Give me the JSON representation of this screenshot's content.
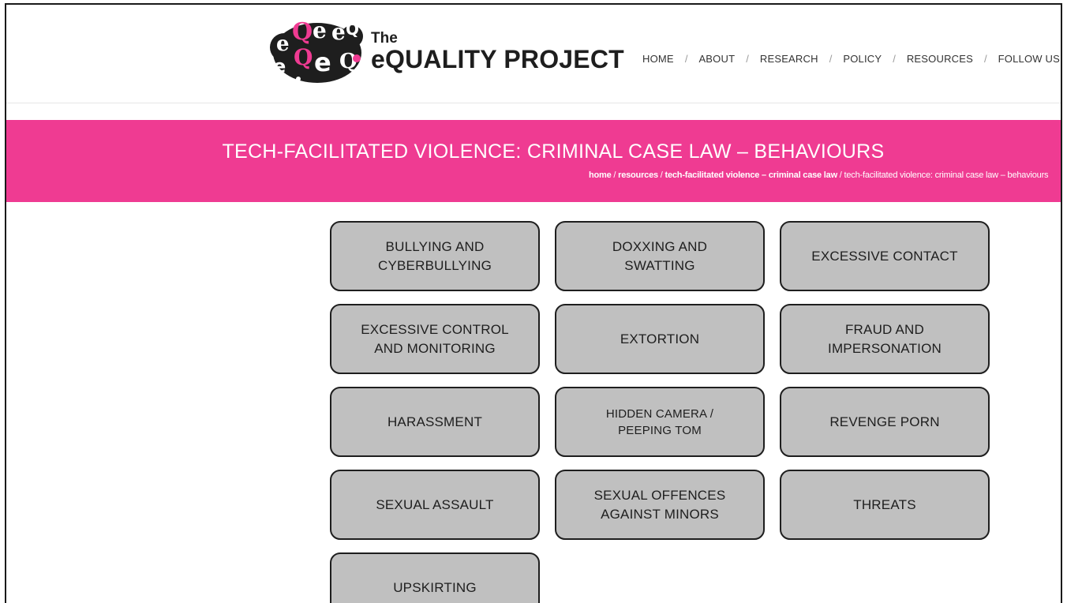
{
  "header": {
    "logo": {
      "the": "The",
      "name": "eQUALITY PROJECT",
      "mark_letters": [
        "e",
        "Q",
        "e",
        "e",
        "Q",
        "e",
        "Q",
        "e",
        "Q"
      ]
    },
    "nav": [
      {
        "label": "HOME"
      },
      {
        "label": "ABOUT"
      },
      {
        "label": "RESEARCH"
      },
      {
        "label": "POLICY"
      },
      {
        "label": "RESOURCES"
      },
      {
        "label": "FOLLOW US"
      }
    ],
    "separator": "/",
    "search_icon": "search-icon",
    "search_glyph": "Q"
  },
  "banner": {
    "title": "TECH-FACILITATED VIOLENCE: CRIMINAL CASE LAW – BEHAVIOURS",
    "breadcrumb": [
      {
        "label": "home",
        "bold": true
      },
      {
        "label": "resources",
        "bold": true
      },
      {
        "label": "tech-facilitated violence – criminal case law",
        "bold": true
      },
      {
        "label": "tech-facilitated violence: criminal case law – behaviours",
        "bold": false
      }
    ],
    "breadcrumb_separator": " / "
  },
  "categories": [
    {
      "label": "BULLYING AND CYBERBULLYING"
    },
    {
      "label": "DOXXING AND SWATTING"
    },
    {
      "label": "EXCESSIVE CONTACT"
    },
    {
      "label": "EXCESSIVE CONTROL AND MONITORING"
    },
    {
      "label": "EXTORTION"
    },
    {
      "label": "FRAUD AND IMPERSONATION"
    },
    {
      "label": "HARASSMENT"
    },
    {
      "label": "HIDDEN CAMERA / PEEPING TOM"
    },
    {
      "label": "REVENGE PORN"
    },
    {
      "label": "SEXUAL ASSAULT"
    },
    {
      "label": "SEXUAL OFFENCES AGAINST MINORS"
    },
    {
      "label": "THREATS"
    },
    {
      "label": "UPSKIRTING"
    }
  ],
  "colors": {
    "accent": "#ef3b92",
    "button_fill": "#c0c0c0",
    "button_border": "#1e1e1e",
    "text_dark": "#1e1e1e"
  }
}
